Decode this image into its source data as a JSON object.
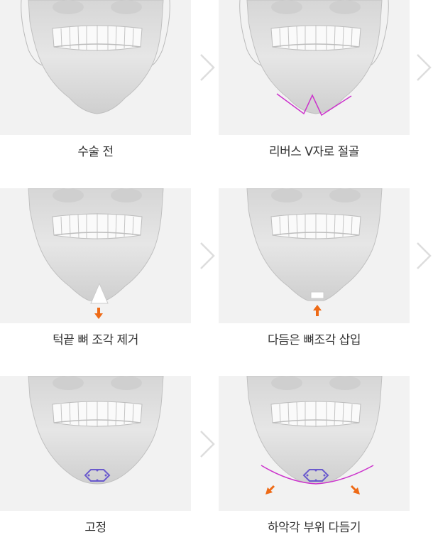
{
  "steps": [
    {
      "label": "수술 전"
    },
    {
      "label": "리버스 V자로 절골"
    },
    {
      "label": "턱끝 뼈 조각 제거"
    },
    {
      "label": "다듬은 뼈조각 삽입"
    },
    {
      "label": "고정"
    },
    {
      "label": "하악각 부위 다듬기"
    }
  ],
  "colors": {
    "panel_bg": "#f2f2f2",
    "cut_line": "#cc33cc",
    "direction_arrow": "#ee6a16",
    "plate": "#6a5acd",
    "next_arrow": "#dddddd"
  },
  "icons": [
    "skull-jaw-illustration",
    "chevron-right-icon",
    "arrow-down-icon",
    "arrow-up-icon",
    "fixation-plate-icon"
  ]
}
